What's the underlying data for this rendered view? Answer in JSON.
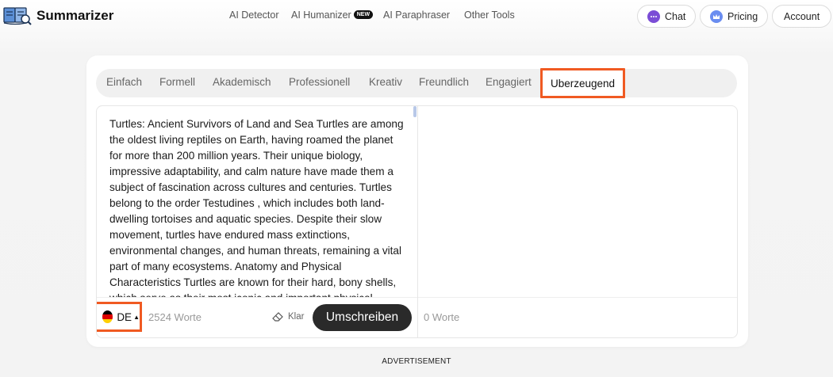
{
  "app": {
    "title": "Summarizer"
  },
  "nav": {
    "items": [
      "AI Detector",
      "AI Humanizer",
      "AI Paraphraser",
      "Other Tools"
    ],
    "humanizer_badge": "NEW"
  },
  "header_buttons": {
    "chat": "Chat",
    "pricing": "Pricing",
    "account": "Account"
  },
  "tabs": [
    {
      "label": "Einfach",
      "active": false
    },
    {
      "label": "Formell",
      "active": false
    },
    {
      "label": "Akademisch",
      "active": false
    },
    {
      "label": "Professionell",
      "active": false
    },
    {
      "label": "Kreativ",
      "active": false
    },
    {
      "label": "Freundlich",
      "active": false
    },
    {
      "label": "Engagiert",
      "active": false
    },
    {
      "label": "Uberzeugend",
      "active": true
    }
  ],
  "input": {
    "text": "Turtles: Ancient Survivors of Land and Sea Turtles are among the oldest living reptiles on Earth, having roamed the planet for more than 200 million years. Their unique biology, impressive adaptability, and calm nature have made them a subject of fascination across cultures and centuries. Turtles belong to the order Testudines , which includes both land-dwelling tortoises and aquatic species. Despite their slow movement, turtles have endured mass extinctions, environmental changes, and human threats, remaining a vital part of many ecosystems. Anatomy and Physical Characteristics Turtles are known for their hard, bony shells, which serve as their most iconic and important physical",
    "language": "DE",
    "word_count": "2524 Worte",
    "clarity_label": "Klar",
    "rewrite_button": "Umschreiben"
  },
  "output": {
    "word_count": "0 Worte"
  },
  "advertisement": "ADVERTISEMENT",
  "colors": {
    "highlight": "#f05a22",
    "button_dark": "#2a2a2a",
    "flag": [
      "#000000",
      "#dd0000",
      "#ffce00"
    ]
  }
}
